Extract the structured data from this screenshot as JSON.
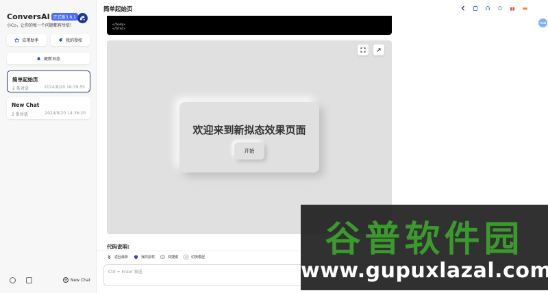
{
  "sidebar": {
    "app_name": "ConversAI",
    "version_badge": "正式版3.8.1",
    "tagline": "小Co，让你的每一个问题都有所依！",
    "buttons": {
      "helper": "应用助手",
      "auth": "我的授权",
      "changelog": "更新日志"
    },
    "chats": [
      {
        "title": "简单起始页",
        "count": "2 条对话",
        "date": "2024/8/20 16:39:55"
      },
      {
        "title": "New Chat",
        "count": "2 条对话",
        "date": "2024/8/20 14:36:20"
      }
    ],
    "new_chat": "New Chat"
  },
  "header": {
    "title": "简单起始页"
  },
  "code": {
    "lines": [
      "</body>",
      "</html>"
    ]
  },
  "preview": {
    "card_title": "欢迎来到新拟态效果页面",
    "start_button": "开始"
  },
  "composer": {
    "section_title": "代码说明:",
    "toolbar": {
      "back_latest": "返回最新",
      "my_auth": "我的授权",
      "shortcuts": "快捷键",
      "switch_model": "切换模型"
    },
    "placeholder": "Ctrl + Enter 发送"
  },
  "avatar": {
    "label": "TWM"
  },
  "watermark": {
    "main": "谷普软件园",
    "url": "www.gupuxlazal.com"
  },
  "colors": {
    "accent": "#4a6cf7",
    "active_border": "#2a3f6e",
    "neo_bg": "#e0e0e0",
    "watermark_green": "#3a9a2d"
  }
}
